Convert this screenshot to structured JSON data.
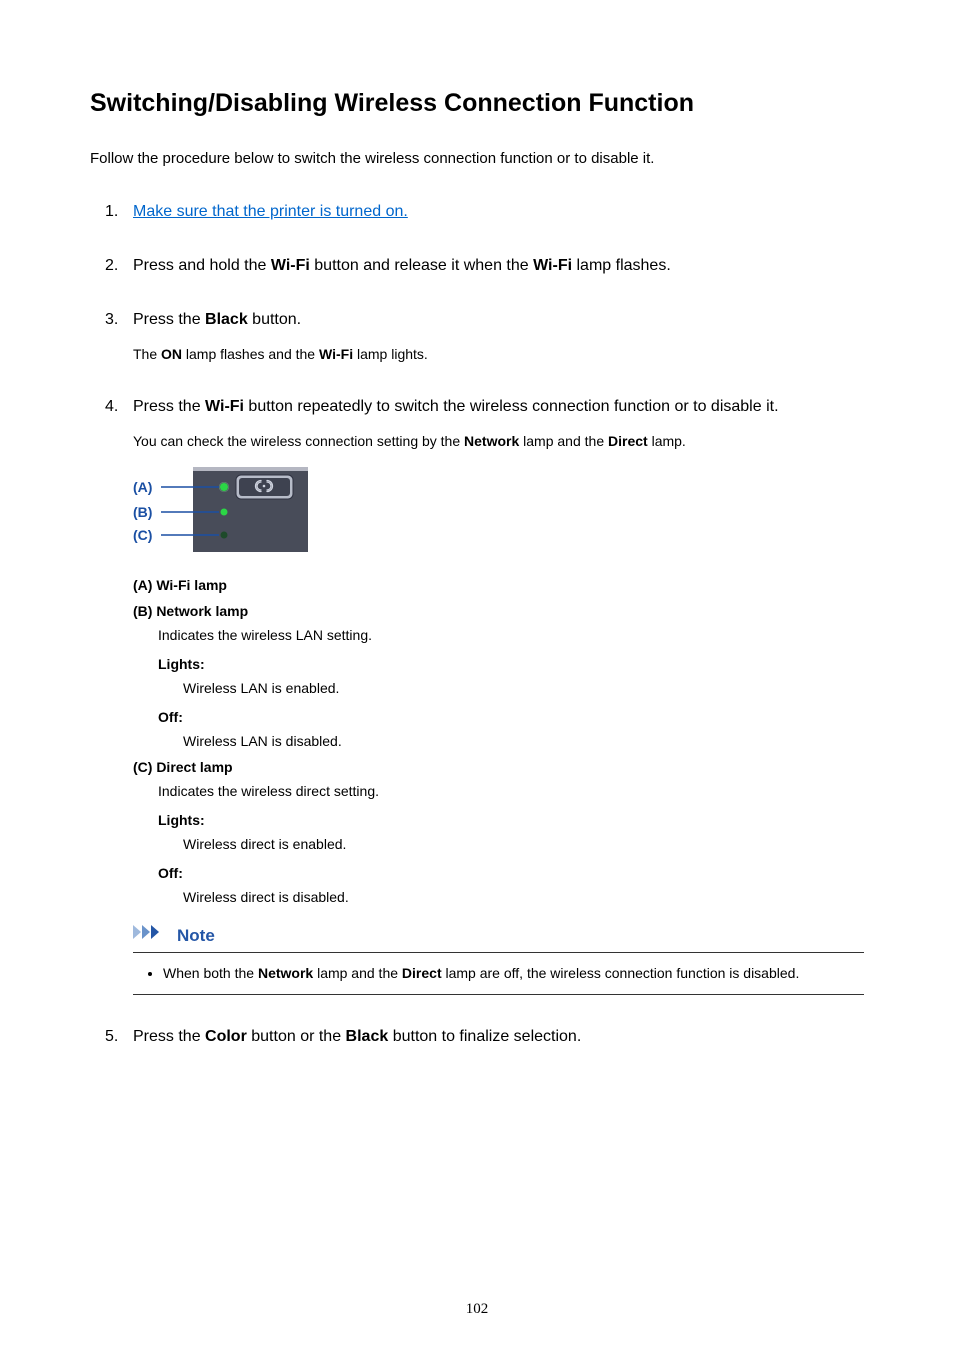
{
  "title": "Switching/Disabling Wireless Connection Function",
  "intro": "Follow the procedure below to switch the wireless connection function or to disable it.",
  "steps": {
    "s1": {
      "link": "Make sure that the printer is turned on."
    },
    "s2": {
      "pre": "Press and hold the ",
      "b1": "Wi-Fi",
      "mid": " button and release it when the ",
      "b2": "Wi-Fi",
      "post": " lamp flashes."
    },
    "s3": {
      "pre": "Press the ",
      "b1": "Black",
      "post": " button.",
      "sub_pre": "The ",
      "sub_b1": "ON",
      "sub_mid": " lamp flashes and the ",
      "sub_b2": "Wi-Fi",
      "sub_post": " lamp lights."
    },
    "s4": {
      "pre": "Press the ",
      "b1": "Wi-Fi",
      "post": " button repeatedly to switch the wireless connection function or to disable it.",
      "sub_pre": "You can check the wireless connection setting by the ",
      "sub_b1": "Network",
      "sub_mid": " lamp and the ",
      "sub_b2": "Direct",
      "sub_post": " lamp.",
      "diagram": {
        "A": "(A)",
        "B": "(B)",
        "C": "(C)"
      },
      "labels": {
        "A_title": "(A) Wi-Fi lamp",
        "B_title": "(B) Network lamp",
        "B_desc": "Indicates the wireless LAN setting.",
        "B_lights": "Lights:",
        "B_lights_desc": "Wireless LAN is enabled.",
        "B_off": "Off:",
        "B_off_desc": "Wireless LAN is disabled.",
        "C_title": "(C) Direct lamp",
        "C_desc": "Indicates the wireless direct setting.",
        "C_lights": "Lights:",
        "C_lights_desc": "Wireless direct is enabled.",
        "C_off": "Off:",
        "C_off_desc": "Wireless direct is disabled."
      },
      "note": {
        "title": "Note",
        "bullet_pre": "When both the ",
        "bullet_b1": "Network",
        "bullet_mid": " lamp and the ",
        "bullet_b2": "Direct",
        "bullet_post": " lamp are off, the wireless connection function is disabled."
      }
    },
    "s5": {
      "pre": "Press the ",
      "b1": "Color",
      "mid": " button or the ",
      "b2": "Black",
      "post": " button to finalize selection."
    }
  },
  "page_number": "102"
}
